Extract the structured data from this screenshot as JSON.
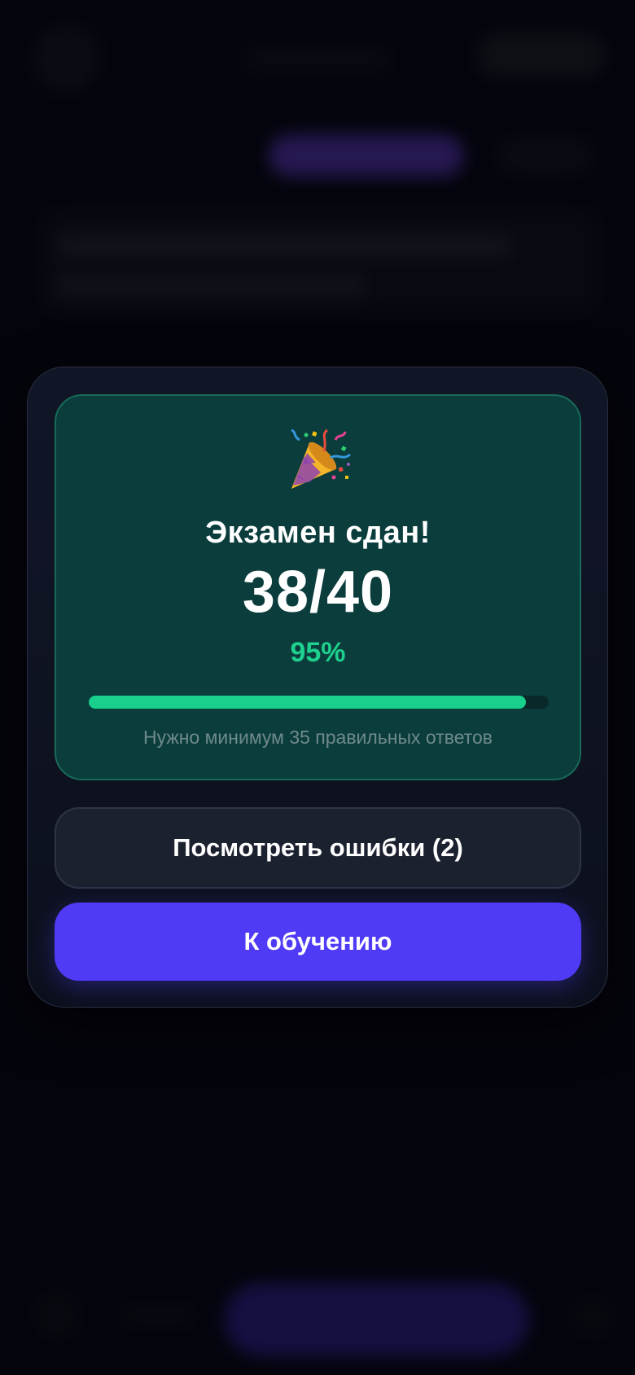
{
  "result": {
    "icon": "party-popper-icon",
    "title": "Экзамен сдан!",
    "score": "38/40",
    "percent": "95%",
    "progress_fraction": 0.95,
    "hint": "Нужно минимум 35 правильных ответов"
  },
  "actions": {
    "review_label": "Посмотреть ошибки (2)",
    "continue_label": "К обучению"
  },
  "colors": {
    "accent": "#4f3bf5",
    "success": "#1ed08e",
    "card_bg": "#0b3d3d"
  }
}
